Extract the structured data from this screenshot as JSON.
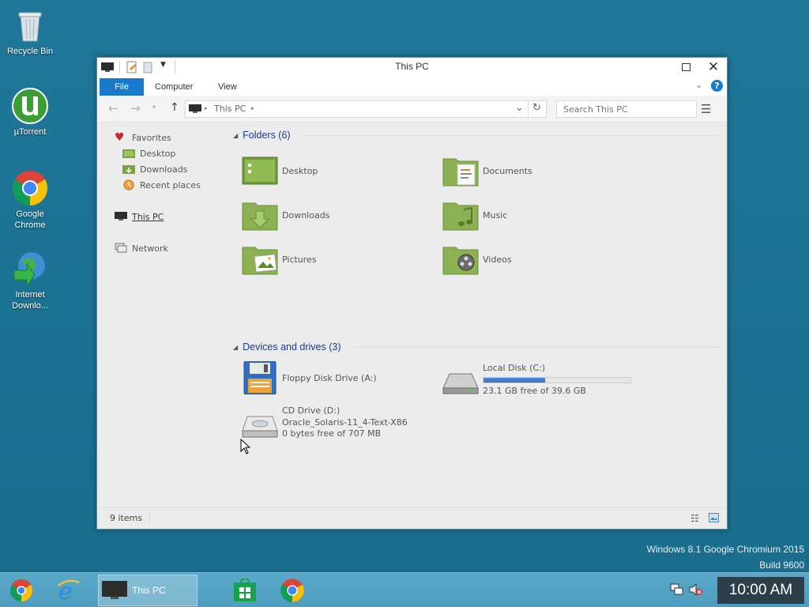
{
  "desktop": {
    "icons": [
      {
        "name": "recycle-bin",
        "label": "Recycle Bin"
      },
      {
        "name": "utorrent",
        "label": "µTorrent"
      },
      {
        "name": "google-chrome",
        "label": "Google Chrome"
      },
      {
        "name": "internet-download-manager",
        "label": "Internet Downlo..."
      }
    ],
    "watermark_line1": "Windows 8.1 Google Chromium 2015",
    "watermark_line2": "Build 9600"
  },
  "window": {
    "title": "This PC",
    "ribbon_tabs": [
      "File",
      "Computer",
      "View"
    ],
    "address_crumb": "This PC",
    "search_placeholder": "Search This PC",
    "nav": {
      "favorites": "Favorites",
      "desktop": "Desktop",
      "downloads": "Downloads",
      "recent": "Recent places",
      "this_pc": "This PC",
      "network": "Network"
    },
    "folders_header": "Folders (6)",
    "folders": [
      "Desktop",
      "Documents",
      "Downloads",
      "Music",
      "Pictures",
      "Videos"
    ],
    "drives_header": "Devices and drives (3)",
    "floppy": {
      "label": "Floppy Disk Drive (A:)"
    },
    "local_disk": {
      "label": "Local Disk (C:)",
      "free_text": "23.1 GB free of 39.6 GB",
      "used_fraction": 0.417
    },
    "cd_drive": {
      "label": "CD Drive (D:)",
      "volume": "Oracle_Solaris-11_4-Text-X86",
      "free_text": "0 bytes free of 707 MB"
    },
    "status_items": "9 items"
  },
  "taskbar": {
    "active_window_label": "This PC",
    "clock": "10:00 AM"
  },
  "colors": {
    "desktop_bg": "#1f7596",
    "accent_file_tab": "#1979ca",
    "folder_green": "#8cb153",
    "taskbar": "#55a3c5"
  }
}
